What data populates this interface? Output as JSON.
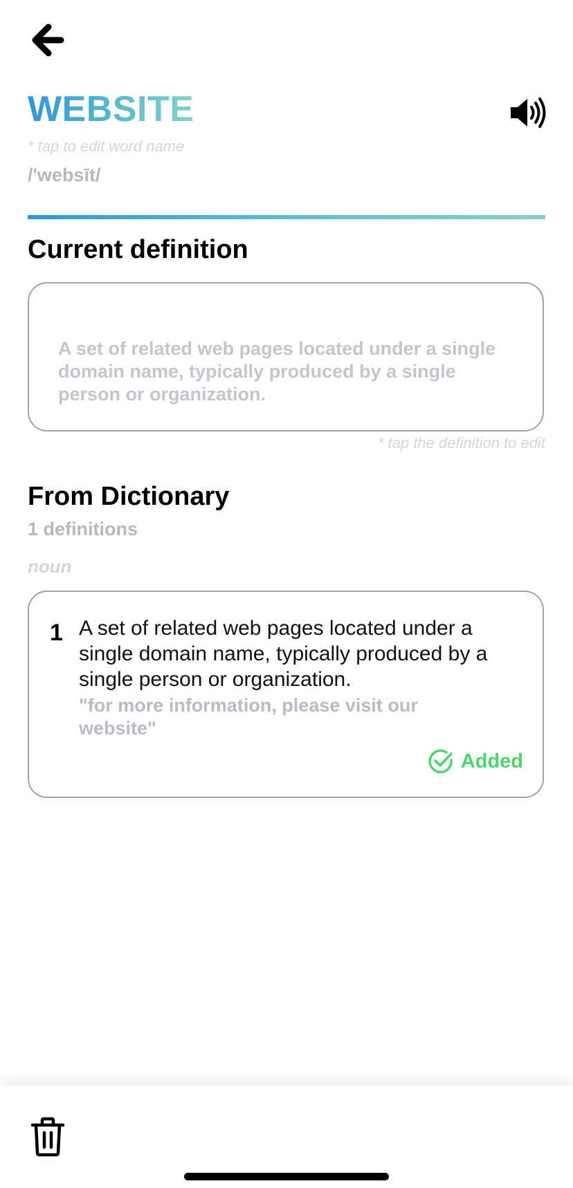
{
  "header": {
    "back_icon": "arrow-left-icon",
    "speaker_icon": "speaker-icon",
    "word": "WEBSITE",
    "edit_hint": "* tap to edit word name",
    "phonetic": "/'websīt/"
  },
  "current_definition": {
    "title": "Current definition",
    "text": "A set of related web pages located under a single domain name, typically produced by a single person or organization.",
    "edit_hint": "* tap the definition to edit"
  },
  "dictionary": {
    "title": "From Dictionary",
    "count_label": "1 definitions",
    "part_of_speech": "noun",
    "entries": [
      {
        "number": "1",
        "definition": "A set of related web pages located under a single domain name, typically produced by a single person or organization.",
        "example": "\"for more information, please visit our website\"",
        "status": "Added"
      }
    ]
  },
  "footer": {
    "delete_icon": "trash-icon"
  },
  "colors": {
    "gradient_start": "#2f96d9",
    "gradient_end": "#86d0c8",
    "added_green": "#4fd36f",
    "muted_text": "#b5b8c0"
  }
}
